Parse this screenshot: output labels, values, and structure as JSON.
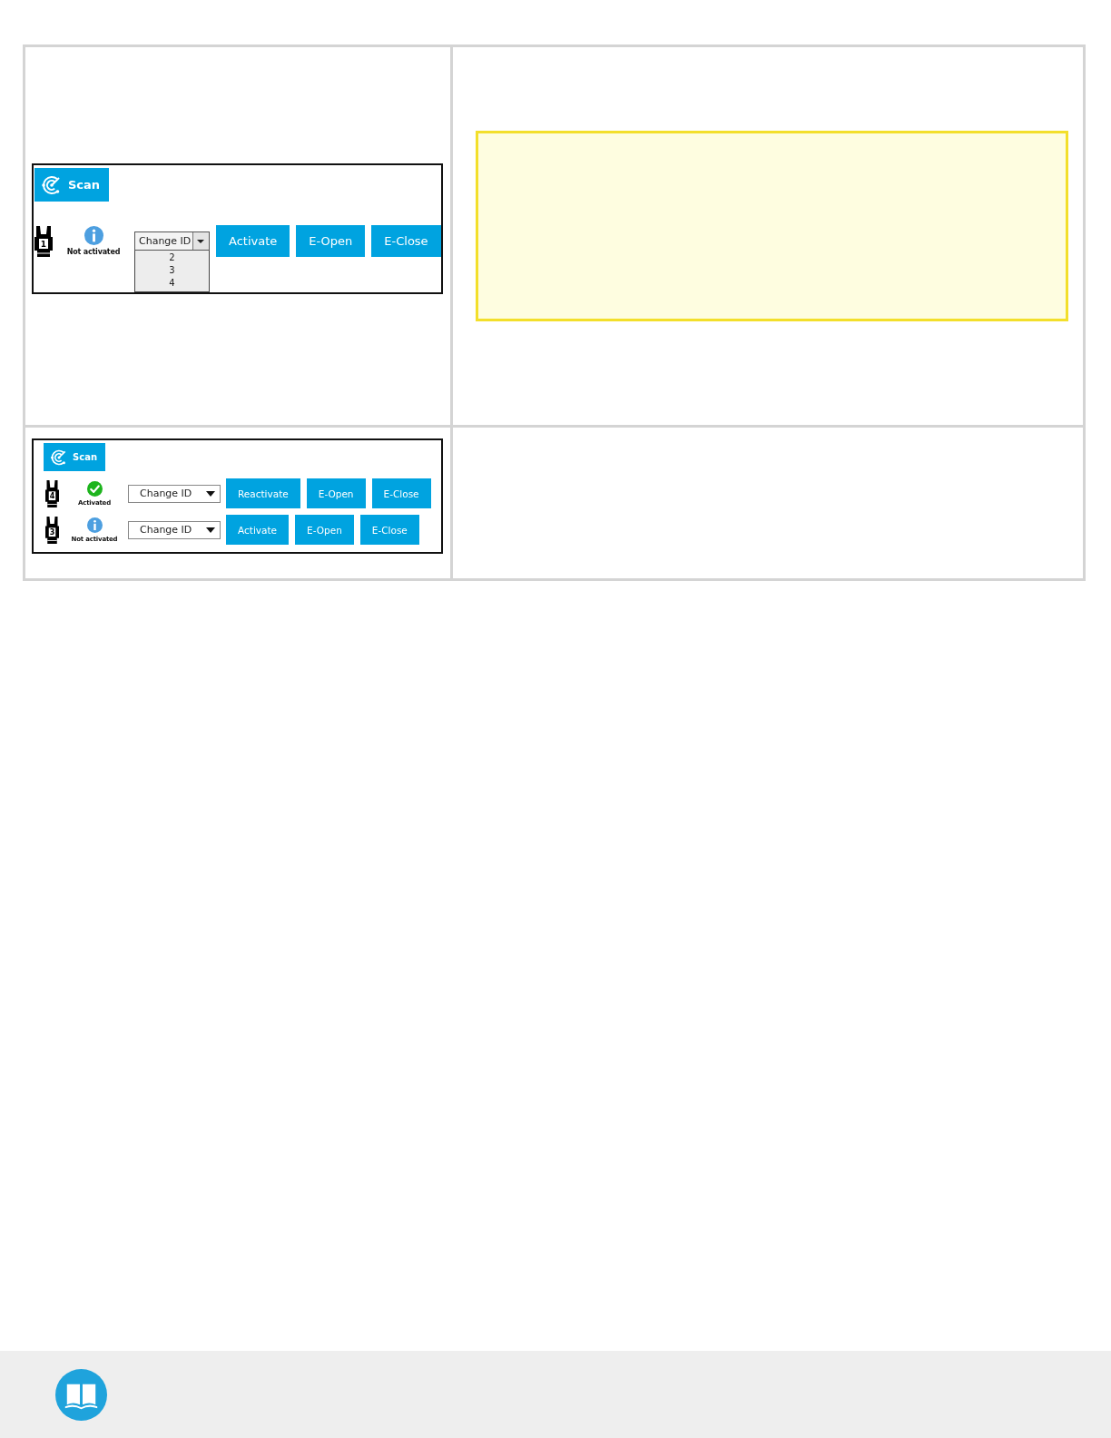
{
  "table": {
    "rows": [
      {
        "screenshot": {
          "scan_button": "Scan",
          "devices": [
            {
              "gripper_id": "1",
              "activated": false,
              "status": "Not activated",
              "dropdown": {
                "value": "Change ID",
                "expanded": true,
                "options": [
                  "2",
                  "3",
                  "4"
                ]
              },
              "buttons": [
                "Activate",
                "E-Open",
                "E-Close"
              ]
            }
          ]
        },
        "callout": {
          "kind": "note"
        }
      },
      {
        "screenshot": {
          "scan_button": "Scan",
          "devices": [
            {
              "gripper_id": "4",
              "activated": true,
              "status": "Activated",
              "dropdown": {
                "value": "Change ID",
                "expanded": false
              },
              "buttons": [
                "Reactivate",
                "E-Open",
                "E-Close"
              ]
            },
            {
              "gripper_id": "3",
              "activated": false,
              "status": "Not activated",
              "dropdown": {
                "value": "Change ID",
                "expanded": false
              },
              "buttons": [
                "Activate",
                "E-Open",
                "E-Close"
              ]
            }
          ]
        }
      }
    ]
  }
}
